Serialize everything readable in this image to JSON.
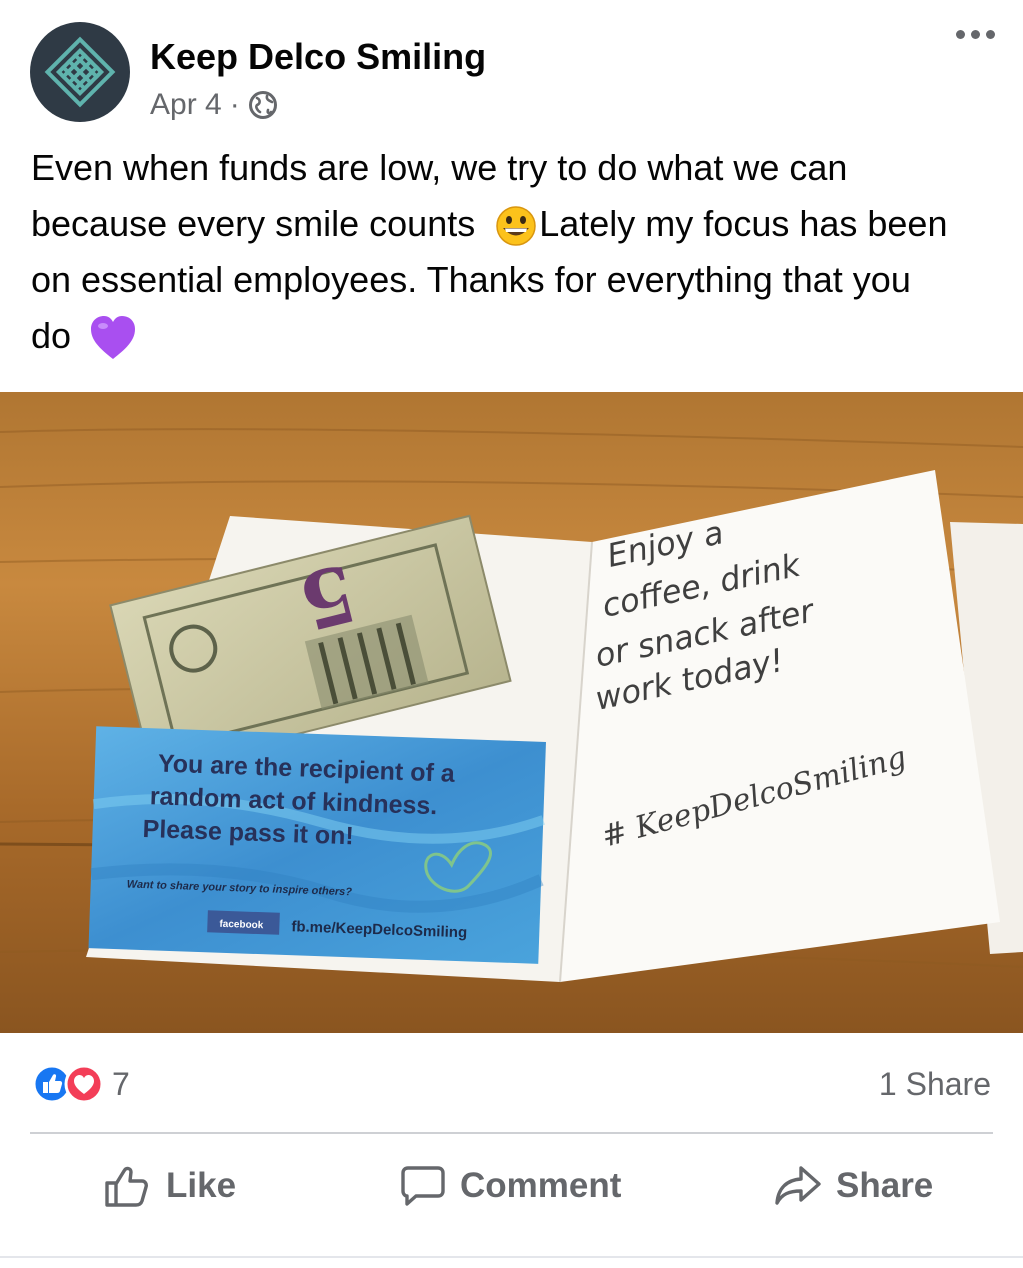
{
  "post": {
    "page_name": "Keep Delco Smiling",
    "date": "Apr 4",
    "separator": "·",
    "text_line1": "Even when funds are low, we try to do what we can",
    "text_line2a": "because every smile counts",
    "text_line2b": "Lately my focus has been",
    "text_line3": "on essential employees.  Thanks for everything that you",
    "text_line4": "do",
    "emojis": [
      "grinning-face",
      "purple-heart"
    ]
  },
  "photo": {
    "note_line1": "Enjoy  a",
    "note_line2": "coffee, drink",
    "note_line3": "or snack after",
    "note_line4": "work  today!",
    "note_hashtag": "# KeepDelcoSmiling",
    "card_line1": "You are the recipient of a",
    "card_line2": "random act of kindness.",
    "card_line3": "Please pass it on!",
    "card_small": "Want to share your story to inspire others?",
    "card_fb_badge": "facebook",
    "card_url": "fb.me/KeepDelcoSmiling",
    "bill_value": "5"
  },
  "stats": {
    "reaction_icons": [
      "like-icon",
      "love-icon"
    ],
    "reaction_count": "7",
    "shares": "1 Share"
  },
  "actions": {
    "like": "Like",
    "comment": "Comment",
    "share": "Share"
  },
  "colors": {
    "link_blue": "#1877f2",
    "love_red": "#f33e58",
    "meta_gray": "#65676b"
  }
}
